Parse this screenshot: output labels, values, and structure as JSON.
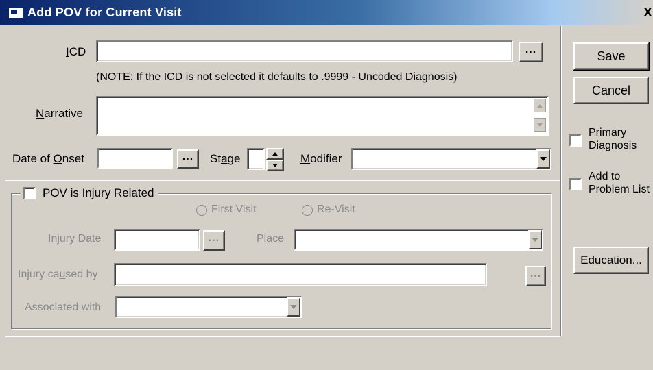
{
  "window": {
    "title": "Add POV for Current Visit",
    "close_glyph": "x"
  },
  "icd": {
    "label_pre": "",
    "label_u": "I",
    "label_post": "CD",
    "value": "",
    "lookup_label": "..."
  },
  "note": "(NOTE: If the  ICD is not selected it defaults to .9999 - Uncoded Diagnosis)",
  "narrative": {
    "label_u": "N",
    "label_post": "arrative",
    "value": ""
  },
  "onset": {
    "label_pre": "Date of ",
    "label_u": "O",
    "label_post": "nset",
    "value": "",
    "lookup_label": "..."
  },
  "stage": {
    "label_pre": "St",
    "label_u": "a",
    "label_post": "ge",
    "value": ""
  },
  "modifier": {
    "label_u": "M",
    "label_post": "odifier",
    "value": ""
  },
  "injury": {
    "checkbox_label": "POV is Injury Related",
    "checked": false,
    "first_visit": "First Visit",
    "revisit": "Re-Visit",
    "date_label_pre": "Injury ",
    "date_label_u": "D",
    "date_label_post": "ate",
    "date_value": "",
    "date_lookup": "...",
    "place_label": "Place",
    "place_value": "",
    "caused_label_pre": "Injury ca",
    "caused_label_u": "u",
    "caused_label_post": "sed by",
    "caused_value": "",
    "caused_lookup": "...",
    "associated_label": "Associated with",
    "associated_value": ""
  },
  "buttons": {
    "save": "Save",
    "cancel": "Cancel",
    "education": "Education..."
  },
  "options": {
    "primary": "Primary Diagnosis",
    "add_problem": "Add to Problem List"
  }
}
